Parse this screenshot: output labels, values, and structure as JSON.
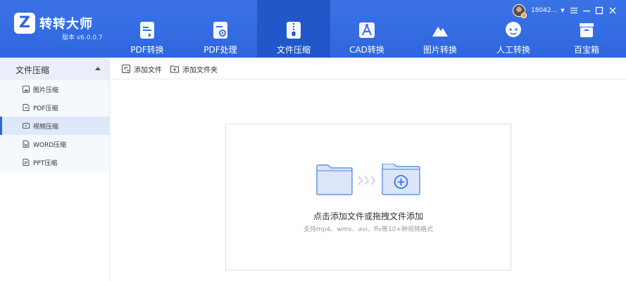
{
  "app": {
    "logo_letter": "Z",
    "name": "转转大师",
    "version": "版本 v6.0.0.7"
  },
  "nav": {
    "items": [
      {
        "label": "PDF转换",
        "icon": "pdf-convert-icon",
        "active": false
      },
      {
        "label": "PDF处理",
        "icon": "pdf-process-icon",
        "active": false
      },
      {
        "label": "文件压缩",
        "icon": "zip-file-icon",
        "active": true
      },
      {
        "label": "CAD转换",
        "icon": "cad-icon",
        "active": false
      },
      {
        "label": "图片转换",
        "icon": "mountain-image-icon",
        "active": false
      },
      {
        "label": "人工转换",
        "icon": "chat-bubble-icon",
        "active": false
      },
      {
        "label": "百宝箱",
        "icon": "toolbox-icon",
        "active": false
      }
    ]
  },
  "user": {
    "name": "18042...",
    "caret": "▼"
  },
  "sidebar": {
    "group_label": "文件压缩",
    "items": [
      {
        "label": "图片压缩",
        "icon": "image-icon",
        "active": false
      },
      {
        "label": "PDF压缩",
        "icon": "pdf-file-icon",
        "active": false
      },
      {
        "label": "视频压缩",
        "icon": "video-icon",
        "active": true
      },
      {
        "label": "WORD压缩",
        "icon": "word-file-icon",
        "active": false
      },
      {
        "label": "PPT压缩",
        "icon": "ppt-file-icon",
        "active": false
      }
    ]
  },
  "toolbar": {
    "add_file_label": "添加文件",
    "add_folder_label": "添加文件夹"
  },
  "dropzone": {
    "title": "点击添加文件或拖拽文件添加",
    "subtitle": "支持mp4、wmv、avi、flv等10+种视频格式"
  },
  "colors": {
    "brand": "#2f66de",
    "active_nav": "#2257c9",
    "sidebar_bg": "#f3f6fc"
  }
}
